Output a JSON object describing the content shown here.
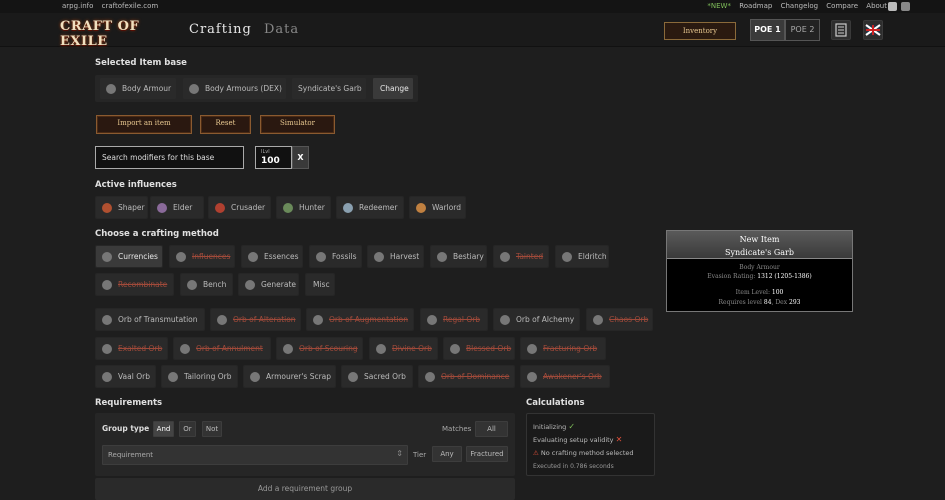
{
  "topbar": {
    "links_left": [
      "arpg.info",
      "craftofexile.com"
    ],
    "new_badge": "*NEW*",
    "links_right": [
      "Roadmap",
      "Changelog",
      "Compare",
      "About"
    ]
  },
  "header": {
    "logo": "CRAFT OF EXILE",
    "nav": [
      "Crafting",
      "Data"
    ],
    "inventory": "Inventory",
    "games": [
      "POE 1",
      "POE 2"
    ]
  },
  "item_base": {
    "title": "Selected Item base",
    "crumbs": [
      "Body Armour",
      "Body Armours (DEX)",
      "Syndicate's Garb"
    ],
    "change": "Change"
  },
  "actions": [
    "Import an item",
    "Reset",
    "Simulator"
  ],
  "search": {
    "placeholder": "Search modifiers for this base",
    "ilvl_label": "ILvl",
    "ilvl_value": "100",
    "clear": "X"
  },
  "influences": {
    "title": "Active influences",
    "items": [
      "Shaper",
      "Elder",
      "Crusader",
      "Hunter",
      "Redeemer",
      "Warlord"
    ]
  },
  "crafting": {
    "title": "Choose a crafting method",
    "methods_row1": [
      {
        "label": "Currencies",
        "struck": false,
        "selected": true
      },
      {
        "label": "Influences",
        "struck": true
      },
      {
        "label": "Essences",
        "struck": false
      },
      {
        "label": "Fossils",
        "struck": false
      },
      {
        "label": "Harvest",
        "struck": false
      },
      {
        "label": "Bestiary",
        "struck": false
      },
      {
        "label": "Tainted",
        "struck": true
      },
      {
        "label": "Eldritch",
        "struck": false
      }
    ],
    "methods_row2": [
      {
        "label": "Recombinate",
        "struck": true
      },
      {
        "label": "Bench",
        "struck": false
      },
      {
        "label": "Generate",
        "struck": false
      },
      {
        "label": "Misc",
        "struck": false,
        "plain": true
      }
    ],
    "currency_rows": [
      [
        {
          "label": "Orb of Transmutation",
          "struck": false
        },
        {
          "label": "Orb of Alteration",
          "struck": true
        },
        {
          "label": "Orb of Augmentation",
          "struck": true
        },
        {
          "label": "Regal Orb",
          "struck": true
        },
        {
          "label": "Orb of Alchemy",
          "struck": false
        },
        {
          "label": "Chaos Orb",
          "struck": true
        }
      ],
      [
        {
          "label": "Exalted Orb",
          "struck": true
        },
        {
          "label": "Orb of Annulment",
          "struck": true
        },
        {
          "label": "Orb of Scouring",
          "struck": true
        },
        {
          "label": "Divine Orb",
          "struck": true
        },
        {
          "label": "Blessed Orb",
          "struck": true
        },
        {
          "label": "Fracturing Orb",
          "struck": true
        }
      ],
      [
        {
          "label": "Vaal Orb",
          "struck": false
        },
        {
          "label": "Tailoring Orb",
          "struck": false
        },
        {
          "label": "Armourer's Scrap",
          "struck": false
        },
        {
          "label": "Sacred Orb",
          "struck": false
        },
        {
          "label": "Orb of Dominance",
          "struck": true
        },
        {
          "label": "Awakener's Orb",
          "struck": true
        }
      ]
    ]
  },
  "item_preview": {
    "name1": "New Item",
    "name2": "Syndicate's Garb",
    "type": "Body Armour",
    "evasion_label": "Evasion Rating:",
    "evasion_value": "1312 (1205-1386)",
    "level_label": "Item Level:",
    "level_value": "100",
    "req_label": "Requires level",
    "req_level": "84",
    "req_dex_label": ", Dex",
    "req_dex": "293"
  },
  "requirements": {
    "title": "Requirements",
    "group_type_label": "Group type",
    "group_types": [
      "And",
      "Or",
      "Not"
    ],
    "matches_label": "Matches",
    "matches_value": "All",
    "requirement_placeholder": "Requirement",
    "tier_label": "Tier",
    "tier_value": "Any",
    "fractured": "Fractured",
    "add_group": "Add a requirement group"
  },
  "calculations": {
    "title": "Calculations",
    "initializing": "Initializing",
    "evaluating": "Evaluating setup validity",
    "no_method": "No crafting method selected",
    "executed": "Executed in 0.786 seconds"
  },
  "colors": {
    "struck": "#a04a3a",
    "accent": "#e8c890",
    "ok": "#7fbf5a",
    "error": "#e0503a"
  }
}
